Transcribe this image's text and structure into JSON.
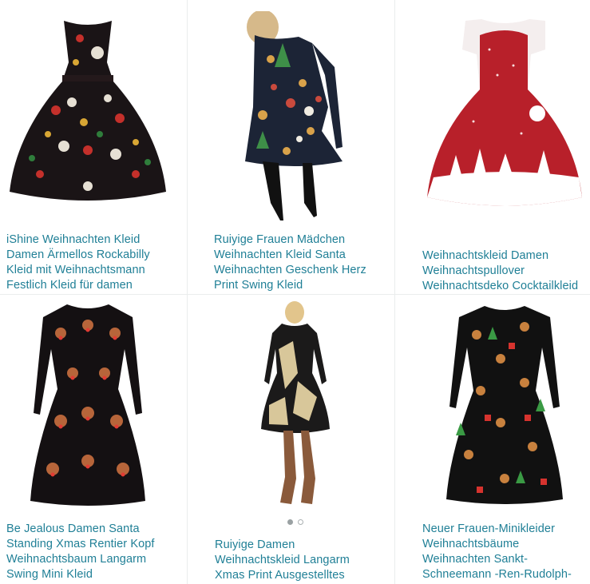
{
  "products": [
    {
      "title": "iShine Weihnachten Kleid Damen Ärmellos Rockabilly Kleid mit Weihnachtsmann Festlich Kleid für damen",
      "image_icon": "dress-image",
      "colors": {
        "dress": "#1a1416",
        "pattern": "#c4302b"
      }
    },
    {
      "title": "Ruiyige Frauen Mädchen Weihnachten Kleid Santa Weihnachten Geschenk Herz Print Swing Kleid",
      "image_icon": "dress-image",
      "colors": {
        "dress": "#1c2436",
        "pattern": "#d9a24a"
      }
    },
    {
      "title": "Weihnachtskleid Damen Weihnachtspullover Weihnachtsdeko Cocktailkleid",
      "image_icon": "dress-image",
      "colors": {
        "dress": "#b8202a",
        "pattern": "#ffffff"
      }
    },
    {
      "title": "Be Jealous Damen Santa Standing Xmas Rentier Kopf Weihnachtsbaum Langarm Swing Mini Kleid",
      "image_icon": "dress-image",
      "colors": {
        "dress": "#141012",
        "pattern": "#b7653a"
      }
    },
    {
      "title": "Ruiyige Damen Weihnachtskleid Langarm Xmas Print Ausgestelltes",
      "image_icon": "dress-image",
      "colors": {
        "dress": "#1b1a1a",
        "pattern": "#d8c79a"
      }
    },
    {
      "title": "Neuer Frauen-Minikleider Weihnachtsbäume Weihnachten Sankt-Schneemann -Ren-Rudolph-",
      "image_icon": "dress-image",
      "colors": {
        "dress": "#111111",
        "pattern": "#c8813e"
      }
    }
  ],
  "carousel": {
    "active_index": 0,
    "count": 2
  }
}
